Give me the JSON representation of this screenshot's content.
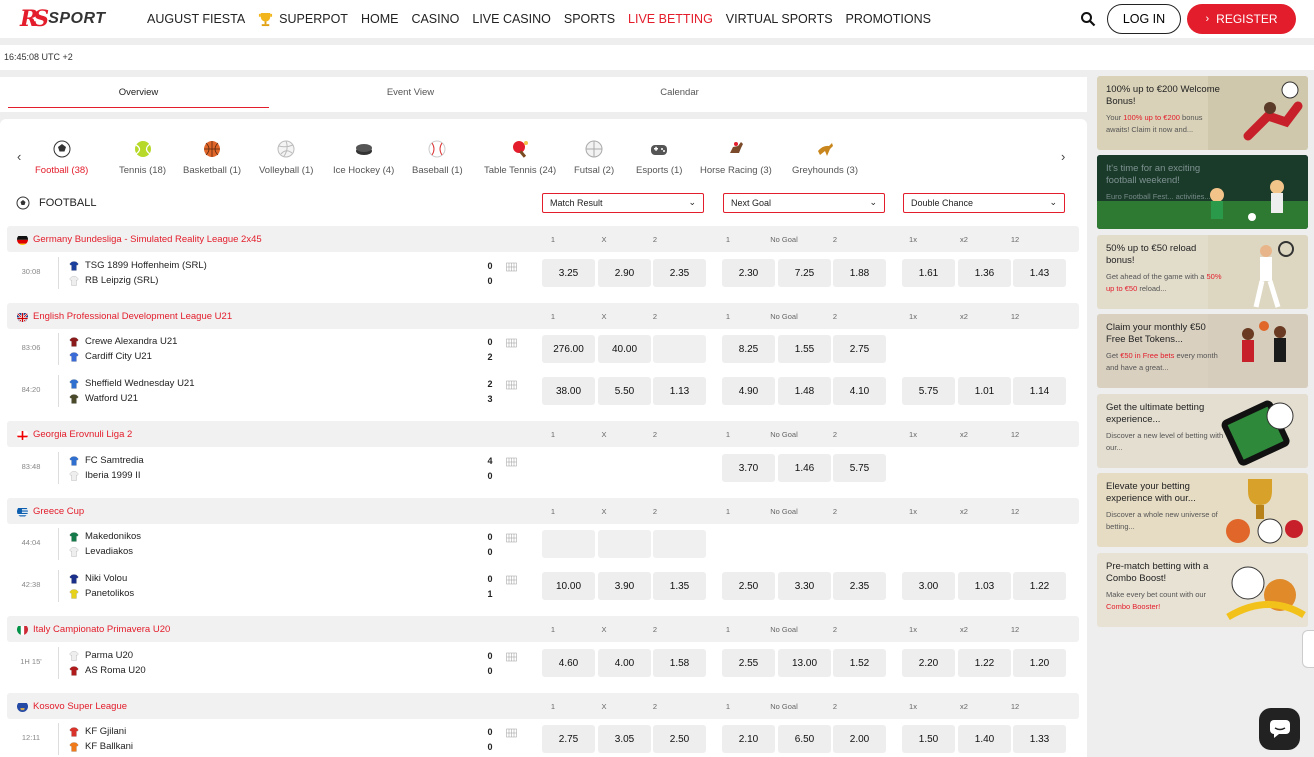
{
  "brand": {
    "logo_r": "R",
    "logo_text": "SPORT"
  },
  "nav": [
    "AUGUST FIESTA",
    "SUPERPOT",
    "HOME",
    "CASINO",
    "LIVE CASINO",
    "SPORTS",
    "LIVE BETTING",
    "VIRTUAL SPORTS",
    "PROMOTIONS"
  ],
  "auth": {
    "login": "LOG IN",
    "register": "REGISTER"
  },
  "clock": "16:45:08 UTC +2",
  "view_tabs": [
    "Overview",
    "Event View",
    "Calendar"
  ],
  "sports": [
    "Football (38)",
    "Tennis (18)",
    "Basketball (1)",
    "Volleyball (1)",
    "Ice Hockey (4)",
    "Baseball (1)",
    "Table Tennis (24)",
    "Futsal (2)",
    "Esports (1)",
    "Horse Racing (3)",
    "Greyhounds (3)"
  ],
  "section_title": "FOOTBALL",
  "markets": [
    "Match Result",
    "Next Goal",
    "Double Chance"
  ],
  "col_headers": [
    "1",
    "X",
    "2",
    "1",
    "No Goal",
    "2",
    "1x",
    "x2",
    "12"
  ],
  "leagues": [
    {
      "name": "Germany Bundesliga - Simulated Reality League 2x45",
      "events": [
        {
          "time": "30:08",
          "home": "TSG 1899 Hoffenheim (SRL)",
          "away": "RB Leipzig (SRL)",
          "hs": "0",
          "as": "0",
          "odds": [
            "3.25",
            "2.90",
            "2.35",
            "2.30",
            "7.25",
            "1.88",
            "1.61",
            "1.36",
            "1.43"
          ]
        }
      ]
    },
    {
      "name": "English Professional Development League U21",
      "events": [
        {
          "time": "83:06",
          "home": "Crewe Alexandra U21",
          "away": "Cardiff City U21",
          "hs": "0",
          "as": "2",
          "odds": [
            "276.00",
            "40.00",
            "",
            "8.25",
            "1.55",
            "2.75",
            null,
            null,
            null
          ]
        },
        {
          "time": "84:20",
          "home": "Sheffield Wednesday U21",
          "away": "Watford U21",
          "hs": "2",
          "as": "3",
          "odds": [
            "38.00",
            "5.50",
            "1.13",
            "4.90",
            "1.48",
            "4.10",
            "5.75",
            "1.01",
            "1.14"
          ]
        }
      ]
    },
    {
      "name": "Georgia Erovnuli Liga 2",
      "events": [
        {
          "time": "83:48",
          "home": "FC Samtredia",
          "away": "Iberia 1999 II",
          "hs": "4",
          "as": "0",
          "odds": [
            null,
            null,
            null,
            "3.70",
            "1.46",
            "5.75",
            null,
            null,
            null
          ]
        }
      ]
    },
    {
      "name": "Greece Cup",
      "events": [
        {
          "time": "44:04",
          "home": "Makedonikos",
          "away": "Levadiakos",
          "hs": "0",
          "as": "0",
          "odds": [
            "",
            "",
            "",
            null,
            null,
            null,
            null,
            null,
            null
          ]
        },
        {
          "time": "42:38",
          "home": "Niki Volou",
          "away": "Panetolikos",
          "hs": "0",
          "as": "1",
          "odds": [
            "10.00",
            "3.90",
            "1.35",
            "2.50",
            "3.30",
            "2.35",
            "3.00",
            "1.03",
            "1.22"
          ]
        }
      ]
    },
    {
      "name": "Italy Campionato Primavera U20",
      "events": [
        {
          "time": "1H 15'",
          "home": "Parma U20",
          "away": "AS Roma U20",
          "hs": "0",
          "as": "0",
          "odds": [
            "4.60",
            "4.00",
            "1.58",
            "2.55",
            "13.00",
            "1.52",
            "2.20",
            "1.22",
            "1.20"
          ]
        }
      ]
    },
    {
      "name": "Kosovo Super League",
      "events": [
        {
          "time": "12:11",
          "home": "KF Gjilani",
          "away": "KF Ballkani",
          "hs": "0",
          "as": "0",
          "odds": [
            "2.75",
            "3.05",
            "2.50",
            "2.10",
            "6.50",
            "2.00",
            "1.50",
            "1.40",
            "1.33"
          ]
        }
      ]
    }
  ],
  "banners": [
    {
      "title": "100% up to €200 Welcome Bonus!",
      "desc_a": "Your ",
      "desc_hl": "100% up to €200",
      "desc_b": " bonus awaits! Claim it now and..."
    },
    {
      "title": "It's time for an exciting football weekend!",
      "desc_a": "Euro Football Fest... activities...",
      "desc_hl": "",
      "desc_b": ""
    },
    {
      "title": "50% up to €50 reload bonus!",
      "desc_a": "Get ahead of the game with a ",
      "desc_hl": "50% up to €50",
      "desc_b": " reload..."
    },
    {
      "title": "Claim your monthly €50 Free Bet Tokens...",
      "desc_a": "Get ",
      "desc_hl": "€50 in Free bets",
      "desc_b": " every month and have a great..."
    },
    {
      "title": "Get the ultimate betting experience...",
      "desc_a": "Discover a new level of betting with our...",
      "desc_hl": "",
      "desc_b": ""
    },
    {
      "title": "Elevate your betting experience with our...",
      "desc_a": "Discover a whole new universe of betting...",
      "desc_hl": "",
      "desc_b": ""
    },
    {
      "title": "Pre-match betting with a Combo Boost!",
      "desc_a": "Make every bet count with our ",
      "desc_hl": "Combo Booster!",
      "desc_b": ""
    }
  ],
  "colors": {
    "accent": "#e31d2b",
    "odds_bg": "#eeeeee",
    "league_bg": "#f1f1f1"
  }
}
